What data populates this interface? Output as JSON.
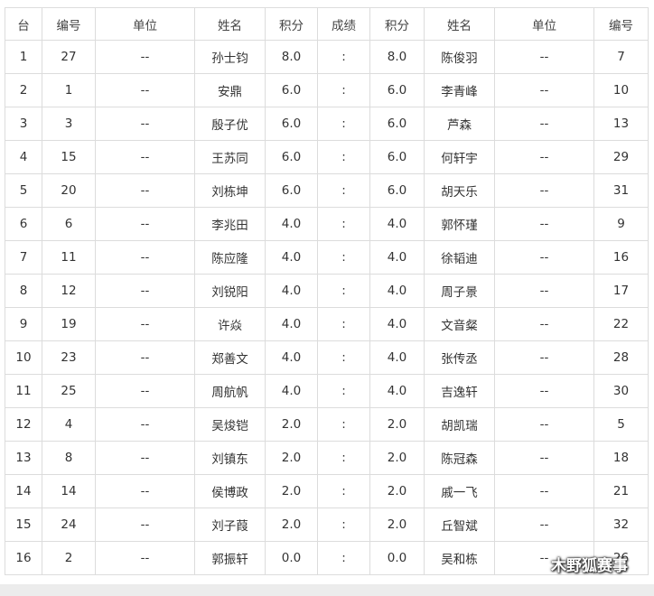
{
  "table": {
    "headers": [
      "台",
      "编号",
      "单位",
      "姓名",
      "积分",
      "成绩",
      "积分",
      "姓名",
      "单位",
      "编号"
    ],
    "rows": [
      [
        "1",
        "27",
        "--",
        "孙士钧",
        "8.0",
        ":",
        "8.0",
        "陈俊羽",
        "--",
        "7"
      ],
      [
        "2",
        "1",
        "--",
        "安鼎",
        "6.0",
        ":",
        "6.0",
        "李青峰",
        "--",
        "10"
      ],
      [
        "3",
        "3",
        "--",
        "殷子优",
        "6.0",
        ":",
        "6.0",
        "芦森",
        "--",
        "13"
      ],
      [
        "4",
        "15",
        "--",
        "王苏同",
        "6.0",
        ":",
        "6.0",
        "何轩宇",
        "--",
        "29"
      ],
      [
        "5",
        "20",
        "--",
        "刘栋坤",
        "6.0",
        ":",
        "6.0",
        "胡天乐",
        "--",
        "31"
      ],
      [
        "6",
        "6",
        "--",
        "李兆田",
        "4.0",
        ":",
        "4.0",
        "郭怀瑾",
        "--",
        "9"
      ],
      [
        "7",
        "11",
        "--",
        "陈应隆",
        "4.0",
        ":",
        "4.0",
        "徐韬迪",
        "--",
        "16"
      ],
      [
        "8",
        "12",
        "--",
        "刘锐阳",
        "4.0",
        ":",
        "4.0",
        "周子景",
        "--",
        "17"
      ],
      [
        "9",
        "19",
        "--",
        "许焱",
        "4.0",
        ":",
        "4.0",
        "文音粲",
        "--",
        "22"
      ],
      [
        "10",
        "23",
        "--",
        "郑善文",
        "4.0",
        ":",
        "4.0",
        "张传丞",
        "--",
        "28"
      ],
      [
        "11",
        "25",
        "--",
        "周航帆",
        "4.0",
        ":",
        "4.0",
        "吉逸轩",
        "--",
        "30"
      ],
      [
        "12",
        "4",
        "--",
        "吴焌铠",
        "2.0",
        ":",
        "2.0",
        "胡凯瑞",
        "--",
        "5"
      ],
      [
        "13",
        "8",
        "--",
        "刘镇东",
        "2.0",
        ":",
        "2.0",
        "陈冠森",
        "--",
        "18"
      ],
      [
        "14",
        "14",
        "--",
        "侯博政",
        "2.0",
        ":",
        "2.0",
        "戚一飞",
        "--",
        "21"
      ],
      [
        "15",
        "24",
        "--",
        "刘子葭",
        "2.0",
        ":",
        "2.0",
        "丘智斌",
        "--",
        "32"
      ],
      [
        "16",
        "2",
        "--",
        "郭振轩",
        "0.0",
        ":",
        "0.0",
        "吴和栋",
        "--",
        "26"
      ]
    ]
  },
  "watermark": {
    "text": "木野狐赛事",
    "icon": "wechat-icon"
  }
}
